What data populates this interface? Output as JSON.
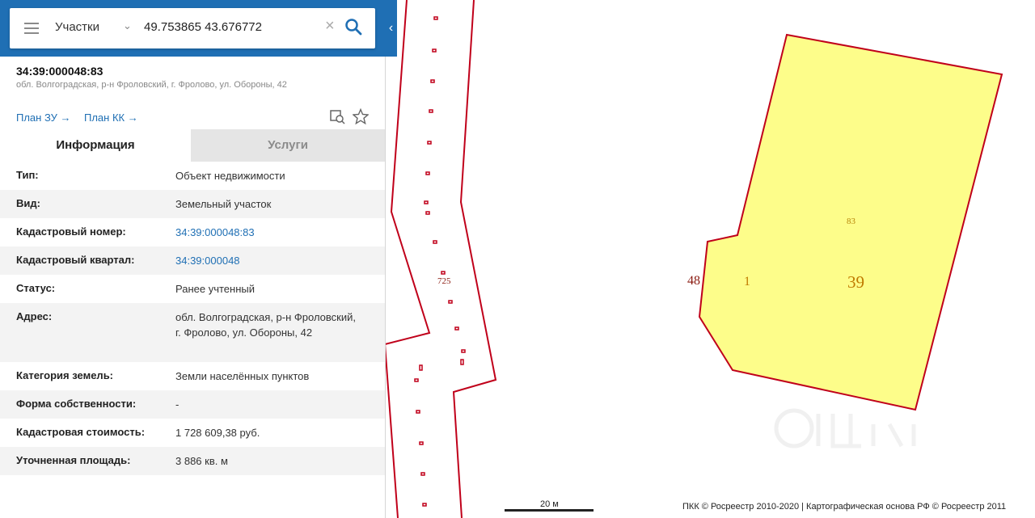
{
  "search": {
    "layer": "Участки",
    "query": "49.753865 43.676772"
  },
  "object": {
    "cadastral_number": "34:39:000048:83",
    "address_short": "обл. Волгоградская, р-н Фроловский, г. Фролово, ул. Обороны, 42"
  },
  "links": {
    "plan_zu": "План ЗУ →",
    "plan_kk": "План КК →"
  },
  "tabs": {
    "info": "Информация",
    "services": "Услуги"
  },
  "details": [
    {
      "label": "Тип:",
      "value": "Объект недвижимости"
    },
    {
      "label": "Вид:",
      "value": "Земельный участок"
    },
    {
      "label": "Кадастровый номер:",
      "value": "34:39:000048:83"
    },
    {
      "label": "Кадастровый квартал:",
      "value": "34:39:000048"
    },
    {
      "label": "Статус:",
      "value": "Ранее учтенный"
    },
    {
      "label": "Адрес:",
      "value": "обл. Волгоградская, р-н Фроловский, г. Фролово, ул. Обороны, 42"
    },
    {
      "label": "Категория земель:",
      "value": "Земли населённых пунктов"
    },
    {
      "label": "Форма собственности:",
      "value": "-"
    },
    {
      "label": "Кадастровая стоимость:",
      "value": "1 728 609,38 руб."
    },
    {
      "label": "Уточненная площадь:",
      "value": "3 886 кв. м"
    }
  ],
  "map": {
    "label_road": "725",
    "label_parcel": "83",
    "label_block": "39",
    "label_48": "48",
    "label_1": "1",
    "scale": "20 м",
    "copyright": "ПКК © Росреестр 2010-2020 | Картографическая основа РФ © Росреестр 2011"
  },
  "colors": {
    "header_blue": "#1f6fb4",
    "parcel_fill": "#fdfd8a",
    "border_red": "#c0001a"
  }
}
